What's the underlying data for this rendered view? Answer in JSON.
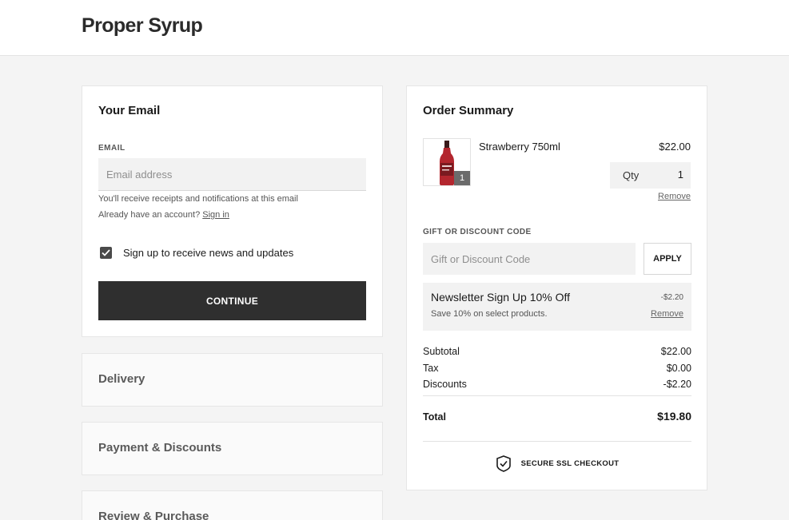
{
  "header": {
    "brand": "Proper Syrup"
  },
  "email_section": {
    "title": "Your Email",
    "field_label": "EMAIL",
    "email_placeholder": "Email address",
    "email_value": "",
    "receipt_hint": "You'll receive receipts and notifications at this email",
    "account_prompt": "Already have an account?",
    "sign_in_link": "Sign in",
    "newsletter_label": "Sign up to receive news and updates",
    "newsletter_checked": true,
    "continue_label": "CONTINUE"
  },
  "steps": [
    {
      "label": "Delivery"
    },
    {
      "label": "Payment & Discounts"
    },
    {
      "label": "Review & Purchase"
    }
  ],
  "order_summary": {
    "title": "Order Summary",
    "items": [
      {
        "name": "Strawberry 750ml",
        "price": "$22.00",
        "qty_label": "Qty",
        "qty": "1",
        "remove_label": "Remove"
      }
    ],
    "discount": {
      "label": "GIFT OR DISCOUNT CODE",
      "placeholder": "Gift or Discount Code",
      "apply_label": "APPLY"
    },
    "promo": {
      "title": "Newsletter Sign Up 10% Off",
      "description": "Save 10% on select products.",
      "amount": "-$2.20",
      "remove_label": "Remove"
    },
    "totals": {
      "subtotal_label": "Subtotal",
      "subtotal": "$22.00",
      "tax_label": "Tax",
      "tax": "$0.00",
      "discounts_label": "Discounts",
      "discounts": "-$2.20",
      "total_label": "Total",
      "total": "$19.80"
    },
    "secure_label": "SECURE SSL CHECKOUT"
  },
  "colors": {
    "background": "#f4f4f4",
    "primary_button": "#2f2f2f",
    "input_fill": "#f2f2f2",
    "bottle_red": "#b3262e"
  },
  "icons": [
    "checkbox-check-icon",
    "syrup-bottle-image",
    "shield-check-icon"
  ]
}
